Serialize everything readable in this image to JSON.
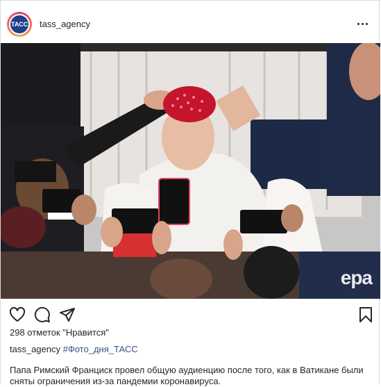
{
  "post": {
    "username": "tass_agency",
    "avatar_text": "ТАСС",
    "watermark": "epa",
    "likes_text": "298 отметок \"Нравится\"",
    "caption_user": "tass_agency",
    "caption_tag": "#Фото_дня_ТАСС",
    "description": "Папа Римский Франциск провел общую аудиенцию после того, как в Ватикане были сняты ограничения из-за пандемии коронавируса."
  },
  "icons": {
    "more": "more-options-icon",
    "like": "heart-icon",
    "comment": "comment-icon",
    "share": "share-icon",
    "save": "bookmark-icon"
  },
  "colors": {
    "hashtag": "#385185",
    "avatar_brand": "#1f3f8c"
  }
}
